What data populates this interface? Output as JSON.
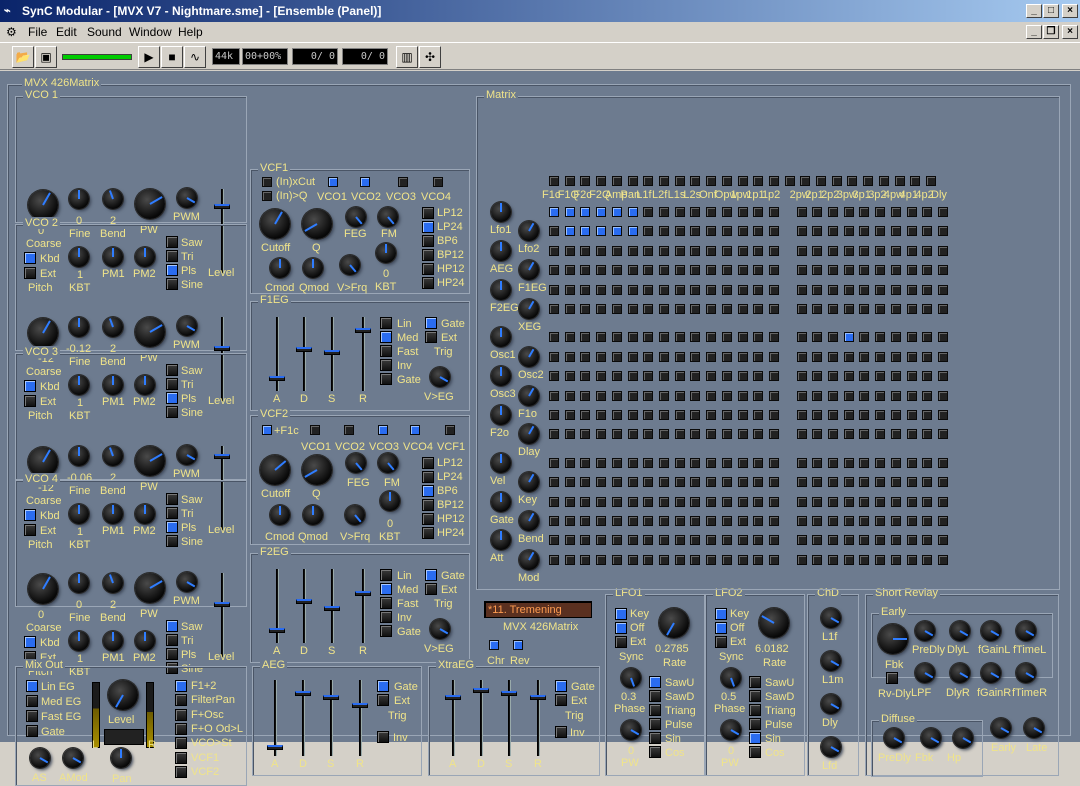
{
  "window": {
    "title": "SynC Modular - [MVX V7 - Nightmare.sme] - [Ensemble (Panel)]"
  },
  "menu": [
    "File",
    "Edit",
    "Sound",
    "Window",
    "Help"
  ],
  "toolbar": {
    "sample_rate": "44k",
    "cpu": "00+00%",
    "counter1": "0/ 0",
    "counter2": "0/ 0"
  },
  "panel": {
    "title": "MVX 426Matrix"
  },
  "vco": [
    {
      "title": "VCO 1",
      "coarse": "0",
      "fine": "0",
      "bend": "2",
      "pm1": "1"
    },
    {
      "title": "VCO 2",
      "coarse": "-12",
      "fine": "-0.12",
      "bend": "2",
      "pm1": "1"
    },
    {
      "title": "VCO 3",
      "coarse": "-12",
      "fine": "-0.06",
      "bend": "2",
      "pm1": "1"
    },
    {
      "title": "VCO 4",
      "coarse": "0",
      "fine": "0",
      "bend": "2",
      "pm1": "1"
    }
  ],
  "vco_labels": {
    "coarse": "Coarse",
    "fine": "Fine",
    "bend": "Bend",
    "pw": "PW",
    "pwm": "PWM",
    "kbd": "Kbd",
    "ext": "Ext",
    "pitch": "Pitch",
    "kbt": "KBT",
    "pm1": "PM1",
    "pm2": "PM2",
    "level": "Level",
    "saw": "Saw",
    "tri": "Tri",
    "pls": "Pls",
    "sine": "Sine"
  },
  "vcf1": {
    "title": "VCF1",
    "inxcut": "(In)xCut",
    "inq": "(In)>Q",
    "sources": [
      "VCO1",
      "VCO2",
      "VCO3",
      "VCO4"
    ],
    "cutoff": "Cutoff",
    "q": "Q",
    "feg": "FEG",
    "fm": "FM",
    "cmod": "Cmod",
    "qmod": "Qmod",
    "vfrq": "V>Frq",
    "kbt": "KBT",
    "kbt_val": "0",
    "modes": [
      "LP12",
      "LP24",
      "BP6",
      "BP12",
      "HP12",
      "HP24"
    ]
  },
  "vcf2": {
    "title": "VCF2",
    "f1c": "+F1c",
    "sources": [
      "VCO1",
      "VCO2",
      "VCO3",
      "VCO4",
      "VCF1"
    ],
    "cutoff": "Cutoff",
    "q": "Q",
    "feg": "FEG",
    "fm": "FM",
    "cmod": "Cmod",
    "qmod": "Qmod",
    "vfrq": "V>Frq",
    "kbt": "KBT",
    "kbt_val": "0",
    "modes": [
      "LP12",
      "LP24",
      "BP6",
      "BP12",
      "HP12",
      "HP24"
    ]
  },
  "f1eg": {
    "title": "F1EG",
    "adsr": [
      "A",
      "D",
      "S",
      "R"
    ],
    "curve": [
      "Lin",
      "Med",
      "Fast",
      "Inv",
      "Gate"
    ],
    "gate": "Gate",
    "ext": "Ext",
    "trig": "Trig",
    "veg": "V>EG"
  },
  "f2eg": {
    "title": "F2EG",
    "adsr": [
      "A",
      "D",
      "S",
      "R"
    ],
    "curve": [
      "Lin",
      "Med",
      "Fast",
      "Inv",
      "Gate"
    ],
    "gate": "Gate",
    "ext": "Ext",
    "trig": "Trig",
    "veg": "V>EG"
  },
  "aeg": {
    "title": "AEG",
    "adsr": [
      "A",
      "D",
      "S",
      "R"
    ],
    "gate": "Gate",
    "ext": "Ext",
    "trig": "Trig",
    "inv": "Inv"
  },
  "xtraeg": {
    "title": "XtraEG",
    "adsr": [
      "A",
      "D",
      "S",
      "R"
    ],
    "gate": "Gate",
    "ext": "Ext",
    "trig": "Trig",
    "inv": "Inv"
  },
  "mixout": {
    "title": "Mix Out",
    "egs": [
      "Lin EG",
      "Med EG",
      "Fast EG",
      "Gate"
    ],
    "level": "Level",
    "l": "L",
    "r": "R",
    "as": "AS",
    "amod": "AMod",
    "pan": "Pan",
    "routes": [
      "F1+2",
      "FilterPan",
      "F+Osc",
      "F+O Od>L",
      "VCO>St",
      "VCF1",
      "VCF2"
    ]
  },
  "preset": {
    "name": "*11. Tremening",
    "label": "MVX 426Matrix",
    "chr": "Chr",
    "rev": "Rev"
  },
  "lfo1": {
    "title": "LFO1",
    "key": "Key",
    "off": "Off",
    "ext": "Ext",
    "sync": "Sync",
    "rate": "Rate",
    "rate_val": "0.2785",
    "phase": "Phase",
    "phase_val": "0.3",
    "pw": "PW",
    "pw_val": "0",
    "waves": [
      "SawU",
      "SawD",
      "Triang",
      "Pulse",
      "Sin",
      "Cos"
    ]
  },
  "lfo2": {
    "title": "LFO2",
    "key": "Key",
    "off": "Off",
    "ext": "Ext",
    "sync": "Sync",
    "rate": "Rate",
    "rate_val": "6.0182",
    "phase": "Phase",
    "phase_val": "0.5",
    "pw": "PW",
    "pw_val": "0",
    "waves": [
      "SawU",
      "SawD",
      "Triang",
      "Pulse",
      "Sin",
      "Cos"
    ]
  },
  "chd": {
    "title": "ChD",
    "knobs": [
      "L1f",
      "L1m",
      "Dly",
      "Lfd"
    ]
  },
  "revlay": {
    "title": "Short Revlay",
    "early": "Early",
    "fbk": "Fbk",
    "rvdly": "Rv-Dly",
    "knobs_top": [
      "PreDly",
      "DlyL",
      "fGainL",
      "fTimeL"
    ],
    "knobs_bot": [
      "LPF",
      "DlyR",
      "fGainR",
      "fTimeR"
    ],
    "diffuse": "Diffuse",
    "diffuse_knobs": [
      "PreDly",
      "Fbk",
      "Hp"
    ],
    "early2": "Early",
    "late": "Late"
  },
  "matrix": {
    "title": "Matrix",
    "columns": [
      "F1c",
      "F1Q",
      "F2c",
      "F2Q",
      "Amp",
      "Pan",
      "L1f",
      "L2f",
      "L1s",
      "L2s",
      "Onf",
      "Opw",
      "1pw",
      "1p1",
      "1p2",
      "2pw",
      "2p1",
      "2p2",
      "3pw",
      "3p1",
      "3p2",
      "4pw",
      "4p1",
      "4p2",
      "Dly"
    ],
    "rows": [
      "Lfo1",
      "Lfo2",
      "AEG",
      "F1EG",
      "F2EG",
      "XEG",
      "Osc1",
      "Osc2",
      "Osc3",
      "F1o",
      "F2o",
      "Dlay",
      "Vel",
      "Key",
      "Gate",
      "Bend",
      "Att",
      "Mod"
    ],
    "active": [
      [
        0,
        0
      ],
      [
        0,
        1
      ],
      [
        0,
        2
      ],
      [
        0,
        3
      ],
      [
        0,
        4
      ],
      [
        0,
        5
      ],
      [
        1,
        1
      ],
      [
        1,
        2
      ],
      [
        1,
        3
      ],
      [
        1,
        4
      ],
      [
        1,
        5
      ],
      [
        6,
        18
      ]
    ]
  }
}
